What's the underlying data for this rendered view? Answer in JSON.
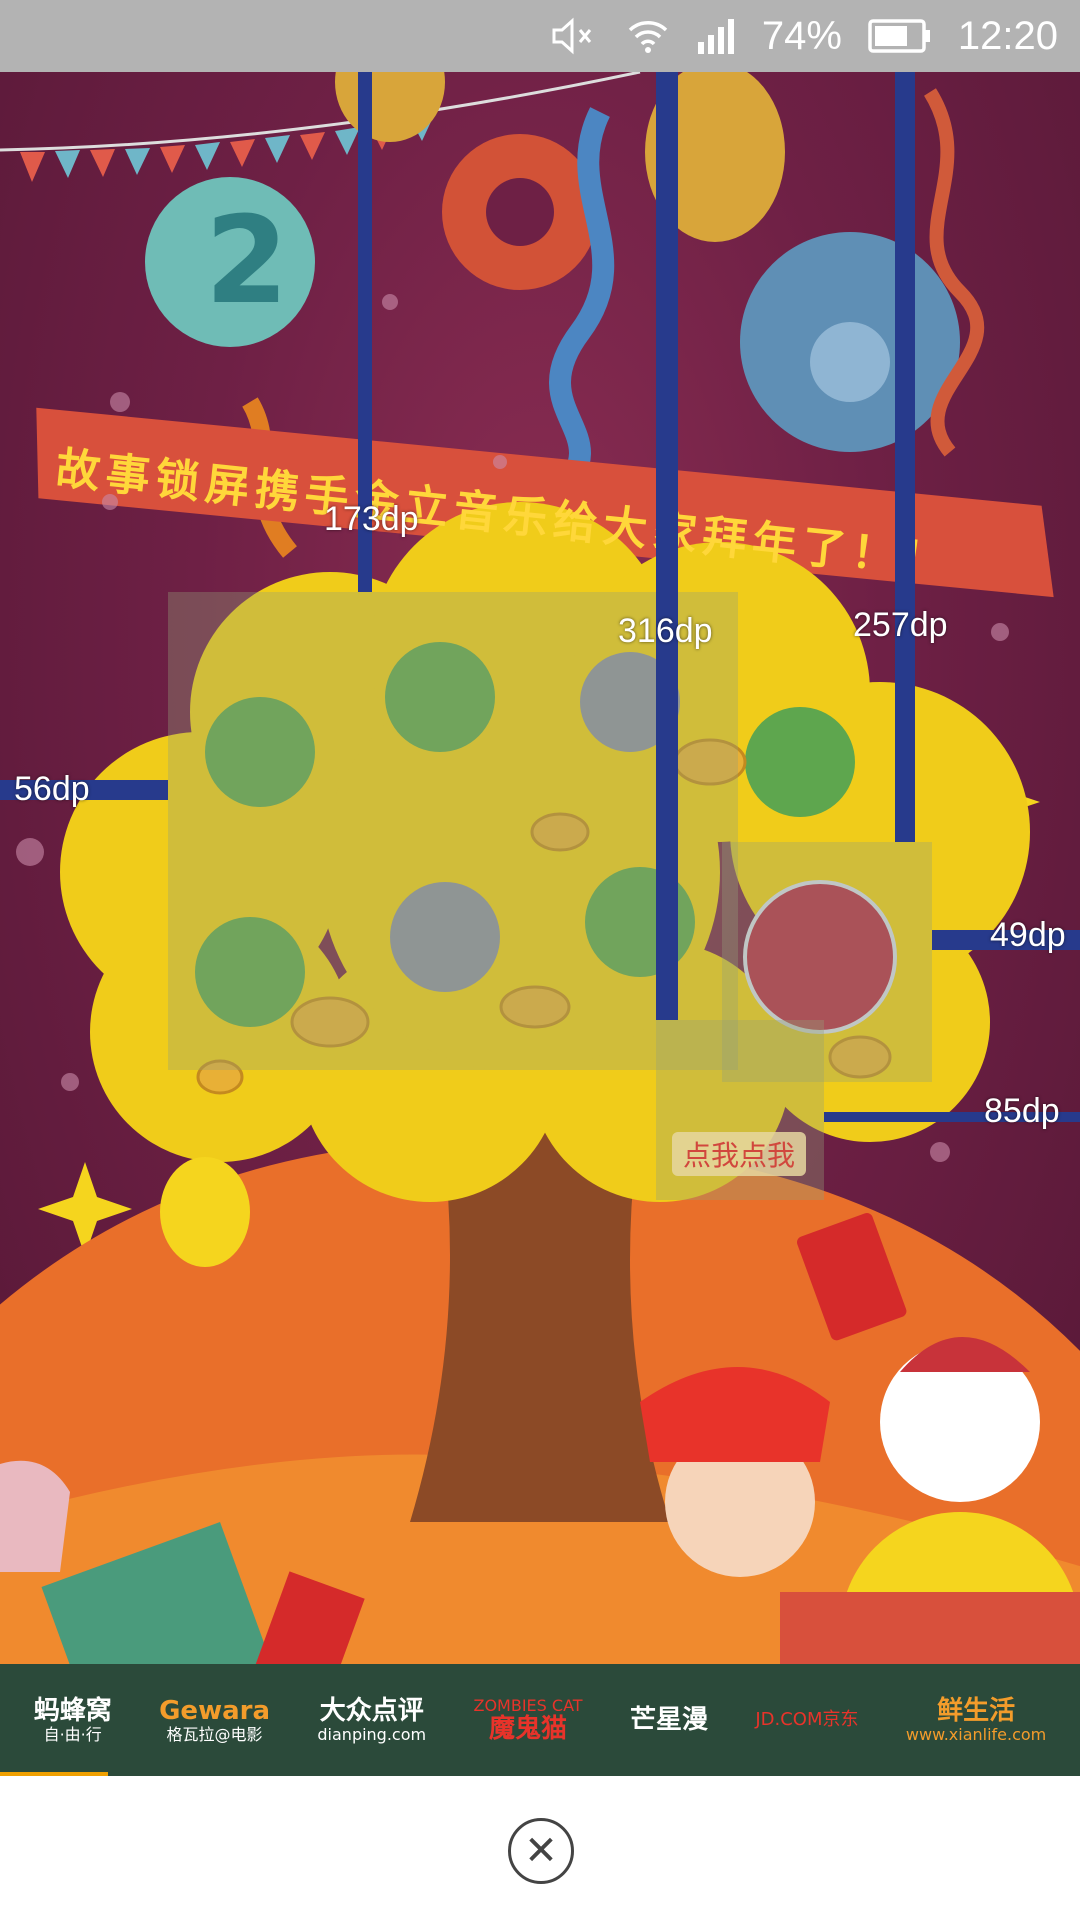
{
  "status_bar": {
    "battery": "74%",
    "time": "12:20",
    "icons": [
      "mute-icon",
      "wifi-icon",
      "signal-icon",
      "battery-icon"
    ]
  },
  "poster": {
    "banner_text": "故事锁屏携手金立音乐给大家拜年了！！",
    "tap_tip": "点我点我"
  },
  "measurements": {
    "m173": "173dp",
    "m316": "316dp",
    "m257": "257dp",
    "m56": "56dp",
    "m49": "49dp",
    "m85": "85dp"
  },
  "partners": [
    {
      "name": "蚂蜂窝",
      "sub": "自·由·行",
      "color": "#ffcc00"
    },
    {
      "name": "Gewara",
      "sub": "格瓦拉@电影",
      "color": "#f39c2b"
    },
    {
      "name": "大众点评",
      "sub": "dianping.com",
      "color": "#ffffff"
    },
    {
      "name": "魔鬼猫",
      "sub": "ZOMBIES CAT",
      "color": "#e8332a"
    },
    {
      "name": "芒星漫",
      "sub": "",
      "color": "#ffffff"
    },
    {
      "name": "JD.COM京东",
      "sub": "",
      "color": "#e8332a"
    },
    {
      "name": "鲜生活",
      "sub": "www.xianlife.com",
      "color": "#f39c2b"
    }
  ],
  "colors": {
    "poster_bg": "#6e2045",
    "guide": "#273a8c",
    "tree": "#f0cc1a",
    "partner_bg": "#2b4a3a"
  }
}
